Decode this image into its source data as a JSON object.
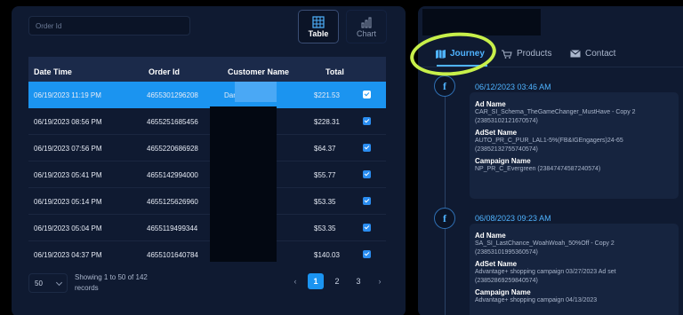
{
  "search": {
    "placeholder": "Order Id"
  },
  "view_toggle": {
    "table_label": "Table",
    "chart_label": "Chart"
  },
  "table": {
    "headers": [
      "Date Time",
      "Order Id",
      "Customer Name",
      "Total"
    ],
    "rows": [
      {
        "date": "06/19/2023 11:19 PM",
        "order": "4655301296208",
        "customer": "Daniel",
        "total": "$221.53",
        "selected": true
      },
      {
        "date": "06/19/2023 08:56 PM",
        "order": "4655251685456",
        "customer": "",
        "total": "$228.31"
      },
      {
        "date": "06/19/2023 07:56 PM",
        "order": "4655220686928",
        "customer": "",
        "total": "$64.37"
      },
      {
        "date": "06/19/2023 05:41 PM",
        "order": "4655142994000",
        "customer": "",
        "total": "$55.77"
      },
      {
        "date": "06/19/2023 05:14 PM",
        "order": "4655125626960",
        "customer": "",
        "total": "$53.35"
      },
      {
        "date": "06/19/2023 05:04 PM",
        "order": "4655119499344",
        "customer": "",
        "total": "$53.35"
      },
      {
        "date": "06/19/2023 04:37 PM",
        "order": "4655101640784",
        "customer": "",
        "total": "$140.03"
      }
    ]
  },
  "footer": {
    "page_size": "50",
    "showing": "Showing 1 to 50 of 142 records",
    "pages": [
      "1",
      "2",
      "3"
    ],
    "prev": "‹",
    "next": "›"
  },
  "tabs": {
    "journey": "Journey",
    "products": "Products",
    "contact": "Contact"
  },
  "journey": [
    {
      "date": "06/12/2023 03:46 AM",
      "ad_name_label": "Ad Name",
      "ad_name": "CAR_SI_Schema_TheGameChanger_MustHave - Copy 2 (23853102121670574)",
      "adset_label": "AdSet Name",
      "adset": "AUTO_PR_C_PUR_LAL1-5%(FB&IGEngagers)24-65 (23852132755740574)",
      "campaign_label": "Campaign Name",
      "campaign": "NP_PR_C_Evergreen (23847474587240574)"
    },
    {
      "date": "06/08/2023 09:23 AM",
      "ad_name_label": "Ad Name",
      "ad_name": "SA_SI_LastChance_WoahWoah_50%Off - Copy 2 (23853101995360574)",
      "adset_label": "AdSet Name",
      "adset": "Advantage+ shopping campaign 03/27/2023 Ad set (23852869259840574)",
      "campaign_label": "Campaign Name",
      "campaign": "Advantage+ shopping campaign 04/13/2023"
    }
  ],
  "colors": {
    "accent": "#1b94f0",
    "highlight": "#c8f04a",
    "panel": "#0f1a31"
  }
}
